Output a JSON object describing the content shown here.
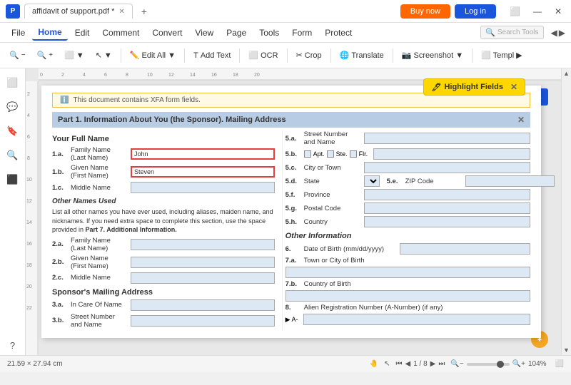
{
  "titlebar": {
    "logo": "P",
    "tab_title": "affidavit of support.pdf *",
    "new_tab": "+",
    "btn_buy": "Buy now",
    "btn_login": "Log in",
    "controls": [
      "⬜",
      "—",
      "✕"
    ]
  },
  "menubar": {
    "items": [
      "File",
      "Home",
      "Edit",
      "Comment",
      "Convert",
      "View",
      "Page",
      "Tools",
      "Form",
      "Protect"
    ]
  },
  "toolbar": {
    "items": [
      {
        "icon": "🔍−",
        "label": ""
      },
      {
        "icon": "🔍+",
        "label": ""
      },
      {
        "icon": "⬜",
        "label": "▼"
      },
      {
        "icon": "⬜",
        "label": "▼"
      },
      {
        "sep": true
      },
      {
        "icon": "✏️",
        "label": "Edit All ▼"
      },
      {
        "sep": true
      },
      {
        "icon": "T",
        "label": "Add Text"
      },
      {
        "sep": true
      },
      {
        "icon": "⬜",
        "label": "OCR"
      },
      {
        "sep": true
      },
      {
        "icon": "✂️",
        "label": "Crop"
      },
      {
        "sep": true
      },
      {
        "icon": "🌐",
        "label": "Translate"
      },
      {
        "sep": true
      },
      {
        "icon": "📷",
        "label": "Screenshot ▼"
      },
      {
        "sep": true
      },
      {
        "icon": "⬜",
        "label": "Templ"
      }
    ],
    "search_placeholder": "Search Tools"
  },
  "highlight_fields": {
    "label": "Highlight Fields"
  },
  "notification": {
    "text": "This document contains XFA form fields."
  },
  "pdf": {
    "header": "Part 1. Information About You (the Sponsor). Mailing Address",
    "section1_title": "Your Full Name",
    "fields": [
      {
        "num": "1.a.",
        "label": "Family Name\n(Last Name)",
        "value": "John",
        "filled": true
      },
      {
        "num": "1.b.",
        "label": "Given Name\n(First Name)",
        "value": "Steven",
        "filled": true
      },
      {
        "num": "1.c.",
        "label": "Middle Name",
        "value": ""
      }
    ],
    "section2_title": "Other Names Used",
    "section2_desc": "List all other names you have ever used, including aliases, maiden name, and nicknames. If you need extra space to complete this section, use the space provided in Part 7. Additional Information.",
    "fields2": [
      {
        "num": "2.a.",
        "label": "Family Name\n(Last Name)",
        "value": ""
      },
      {
        "num": "2.b.",
        "label": "Given Name\n(First Name)",
        "value": ""
      },
      {
        "num": "2.c.",
        "label": "Middle Name",
        "value": ""
      }
    ],
    "section3_title": "Sponsor's Mailing Address",
    "fields3": [
      {
        "num": "3.a.",
        "label": "In Care Of Name",
        "value": ""
      },
      {
        "num": "3.b.",
        "label": "Street Number\nand Name",
        "value": ""
      }
    ],
    "right_col": {
      "fields": [
        {
          "num": "5.a.",
          "label": "Street Number\nand Name",
          "value": ""
        },
        {
          "num": "5.b.",
          "checkboxes": [
            "Apt.",
            "Ste.",
            "Flr."
          ],
          "value": ""
        },
        {
          "num": "5.c.",
          "label": "City or Town",
          "value": ""
        },
        {
          "num": "5.d.",
          "label": "State",
          "dropdown": true,
          "num2": "5.e.",
          "label2": "ZIP Code",
          "value": ""
        },
        {
          "num": "5.f.",
          "label": "Province",
          "value": ""
        },
        {
          "num": "5.g.",
          "label": "Postal Code",
          "value": ""
        },
        {
          "num": "5.h.",
          "label": "Country",
          "value": ""
        }
      ],
      "section_other": "Other Information",
      "other_fields": [
        {
          "num": "6.",
          "label": "Date of Birth (mm/dd/yyyy)",
          "value": ""
        },
        {
          "num": "7.a.",
          "label": "Town or City of Birth",
          "value": ""
        },
        {
          "num": "7.b.",
          "label": "Country of Birth",
          "value": ""
        },
        {
          "num": "8.",
          "label": "Alien Registration Number (A-Number) (if any)",
          "prefix": "▶ A-",
          "value": ""
        }
      ]
    }
  },
  "statusbar": {
    "dimensions": "21.59 × 27.94 cm",
    "page_info": "1 / 8",
    "zoom": "104%",
    "icons": [
      "🤚",
      "↖",
      "⏮",
      "◀",
      "▶",
      "⏭",
      "🔍−",
      "🔍+"
    ]
  }
}
